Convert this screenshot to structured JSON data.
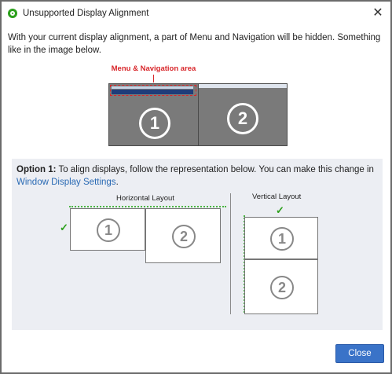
{
  "window": {
    "title": "Unsupported Display Alignment",
    "close_glyph": "✕"
  },
  "intro_text": "With your current display alignment, a part of Menu and Navigation will be hidden. Something like in the image below.",
  "illustration": {
    "callout": "Menu & Navigation area",
    "monitor_1": "1",
    "monitor_2": "2"
  },
  "option1": {
    "heading": "Option 1:",
    "text": "To align displays, follow the representation below. You can make this change in",
    "link": "Window Display Settings",
    "link_suffix": ".",
    "horizontal": {
      "label": "Horizontal Layout",
      "check": "✓",
      "display_1": "1",
      "display_2": "2"
    },
    "vertical": {
      "label": "Vertical Layout",
      "check": "✓",
      "display_1": "1",
      "display_2": "2"
    }
  },
  "footer": {
    "close_label": "Close"
  },
  "colors": {
    "accent": "#3a73c8",
    "callout_red": "#d8262a",
    "check_green": "#2ca01c",
    "panel_bg": "#eceef3"
  },
  "icons": {
    "app": "quickbooks-logo-icon",
    "close": "close-icon",
    "check": "checkmark-icon"
  }
}
